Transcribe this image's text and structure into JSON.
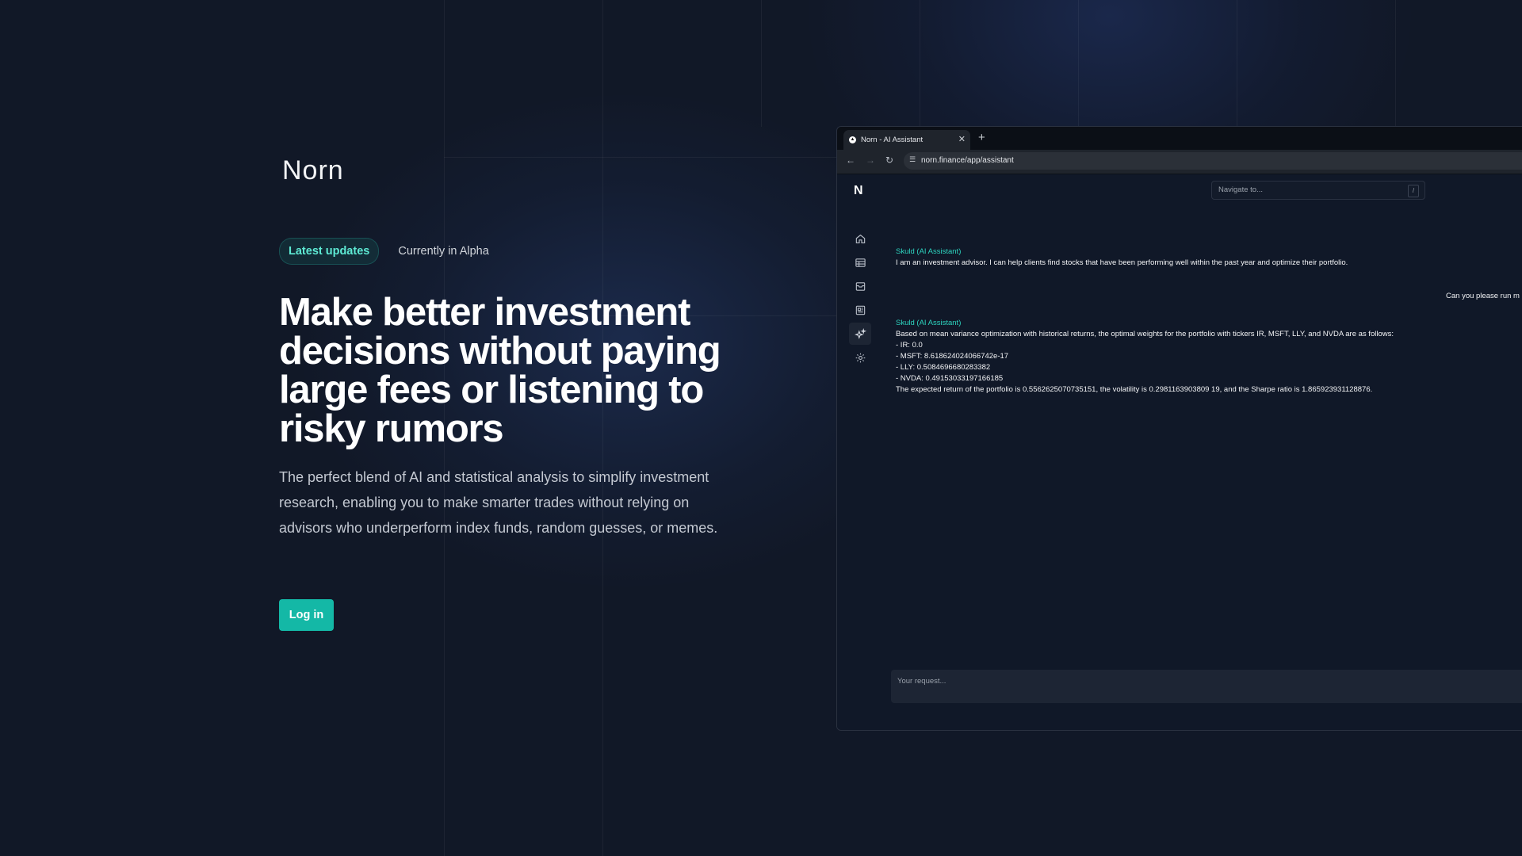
{
  "brand": {
    "logo_text": "Norn"
  },
  "hero": {
    "badge": "Latest updates",
    "badge_side": "Currently in Alpha",
    "headline": "Make better investment decisions without paying large fees or listening to risky rumors",
    "subtext": "The perfect blend of AI and statistical analysis to simplify investment research, enabling you to make smarter trades without relying on advisors who underperform index funds, random guesses, or memes.",
    "login_label": "Log in"
  },
  "browser": {
    "tab_title": "Norn - AI Assistant",
    "url": "norn.finance/app/assistant",
    "icons": {
      "back": "arrow-left-icon",
      "forward": "arrow-right-icon",
      "reload": "reload-icon",
      "site_settings": "tune-icon"
    }
  },
  "app": {
    "logo_text": "N",
    "navigate_placeholder": "Navigate to...",
    "navigate_shortcut": "/",
    "sidebar": [
      {
        "icon": "home-icon"
      },
      {
        "icon": "table-icon"
      },
      {
        "icon": "archive-icon"
      },
      {
        "icon": "newspaper-icon"
      },
      {
        "icon": "sparkles-icon",
        "active": true
      },
      {
        "icon": "gear-icon"
      }
    ],
    "messages": [
      {
        "author": "Skuld (AI Assistant)",
        "lines": [
          "I am an investment advisor. I can help clients find stocks that have been performing well within the past year and optimize their portfolio."
        ]
      },
      {
        "author": "Skuld (AI Assistant)",
        "lines": [
          "Based on mean variance optimization with historical returns, the optimal weights for the portfolio with tickers IR, MSFT, LLY, and NVDA are as follows:",
          "- IR: 0.0",
          "- MSFT: 8.618624024066742e-17",
          "- LLY: 0.5084696680283382",
          "- NVDA: 0.49153033197166185",
          "The expected return of the portfolio is 0.5562625070735151, the volatility is 0.2981163903809 19, and the Sharpe ratio is 1.865923931128876."
        ]
      }
    ],
    "user_message": "Can you please run m",
    "request_placeholder": "Your request..."
  }
}
